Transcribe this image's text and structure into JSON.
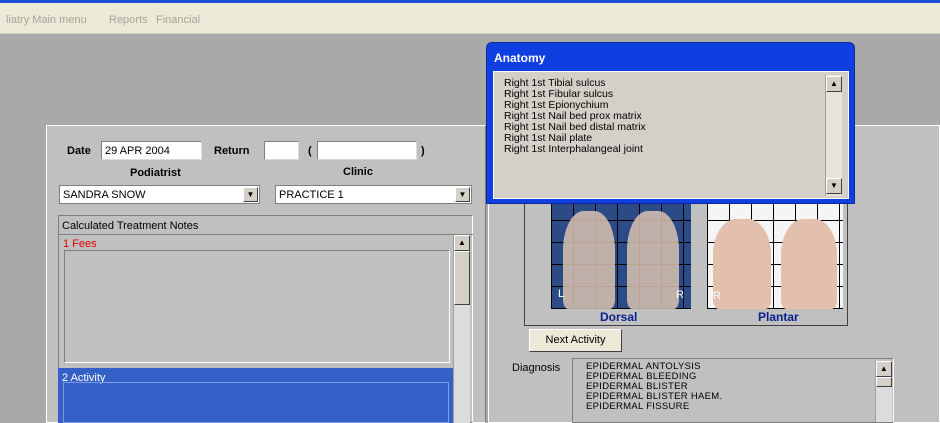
{
  "menu": {
    "items": [
      "liatry Main menu",
      "Reports",
      "Financial"
    ]
  },
  "form": {
    "date_label": "Date",
    "date_value": "29 APR 2004",
    "return_label": "Return",
    "return_value": "",
    "open_paren": "(",
    "paren_value": "",
    "close_paren": ")",
    "podiatrist_label": "Podiatrist",
    "clinic_label": "Clinic",
    "podiatrist_value": "SANDRA SNOW",
    "clinic_value": "PRACTICE 1"
  },
  "notes": {
    "heading": "Calculated Treatment Notes",
    "fees_label": "1  Fees",
    "activity_label": "2 Activity"
  },
  "anatomy": {
    "title": "Anatomy",
    "items": [
      "Right 1st Tibial sulcus",
      "Right 1st Fibular sulcus",
      "Right 1st Epionychium",
      "Right 1st Nail bed prox matrix",
      "Right 1st Nail bed distal matrix",
      "Right 1st Nail plate",
      "Right 1st Interphalangeal joint"
    ]
  },
  "images": {
    "dorsal_left_marker": "L",
    "dorsal_right_marker": "R",
    "plantar_marker": "R",
    "dorsal_caption": "Dorsal",
    "plantar_caption": "Plantar"
  },
  "actions": {
    "next_activity": "Next Activity"
  },
  "diagnosis": {
    "label": "Diagnosis",
    "items": [
      "EPIDERMAL ANTOLYSIS",
      "EPIDERMAL BLEEDING",
      "EPIDERMAL BLISTER",
      "EPIDERMAL BLISTER HAEM.",
      "EPIDERMAL FISSURE"
    ]
  },
  "colors": {
    "title_blue": "#0f3fe0",
    "activity_blue": "#3560c8",
    "fees_red": "#e00000",
    "caption_blue": "#0a1f8f"
  }
}
